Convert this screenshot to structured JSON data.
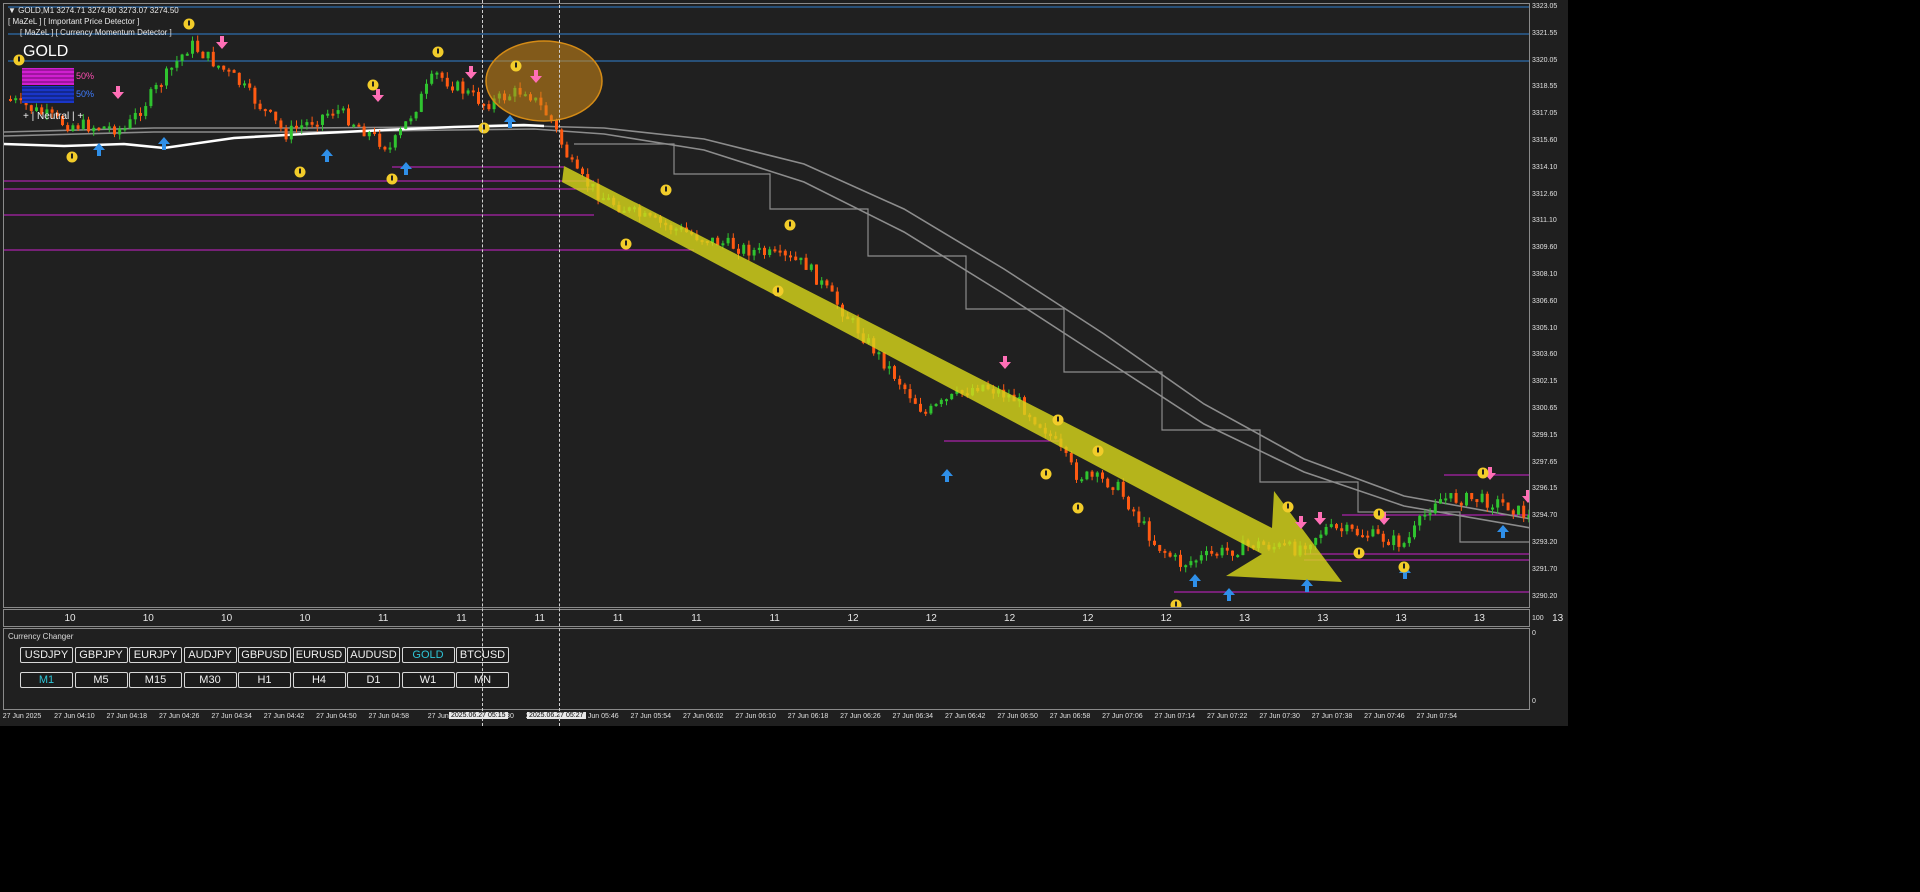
{
  "header": {
    "symbol_line": "▼ GOLD,M1  3274.71 3274.80 3273.07 3274.50",
    "indicator_1": "[ MaZeL ] [ Important Price Detector ]",
    "indicator_2": "[ MaZeL ] [ Currency Momentum Detector ]",
    "gold_label": "GOLD",
    "pct_1": "50%",
    "pct_2": "50%",
    "neutral_label": "+ | Neutral | +"
  },
  "price_scale": [
    "3323.05",
    "3321.55",
    "3320.05",
    "3318.55",
    "3317.05",
    "3315.60",
    "3314.10",
    "3312.60",
    "3311.10",
    "3309.60",
    "3308.10",
    "3306.60",
    "3305.10",
    "3303.60",
    "3302.15",
    "3300.65",
    "3299.15",
    "3297.65",
    "3296.15",
    "3294.70",
    "3293.20",
    "3291.70",
    "3290.20"
  ],
  "hour_labels": [
    "10",
    "10",
    "10",
    "10",
    "11",
    "11",
    "11",
    "11",
    "11",
    "11",
    "12",
    "12",
    "12",
    "12",
    "12",
    "13",
    "13",
    "13",
    "13",
    "13"
  ],
  "panel_scale": {
    "top": "100",
    "mid": "0",
    "bottom": "0"
  },
  "currency_changer": {
    "title": "Currency Changer",
    "symbols": [
      "USDJPY",
      "GBPJPY",
      "EURJPY",
      "AUDJPY",
      "GBPUSD",
      "EURUSD",
      "AUDUSD",
      "GOLD",
      "BTCUSD"
    ],
    "active_symbol": "GOLD",
    "timeframes": [
      "M1",
      "M5",
      "M15",
      "M30",
      "H1",
      "H4",
      "D1",
      "W1",
      "MN"
    ],
    "active_timeframe": "M1"
  },
  "time_axis": [
    "27 Jun 2025",
    "27 Jun 04:10",
    "27 Jun 04:18",
    "27 Jun 04:26",
    "27 Jun 04:34",
    "27 Jun 04:42",
    "27 Jun 04:50",
    "27 Jun 04:58",
    "27 Jun 0",
    "27 Jun 05:30",
    "27 Jun 05:38",
    "27 Jun 05:46",
    "27 Jun 05:54",
    "27 Jun 06:02",
    "27 Jun 06:10",
    "27 Jun 06:18",
    "27 Jun 06:26",
    "27 Jun 06:34",
    "27 Jun 06:42",
    "27 Jun 06:50",
    "27 Jun 06:58",
    "27 Jun 07:06",
    "27 Jun 07:14",
    "27 Jun 07:22",
    "27 Jun 07:30",
    "27 Jun 07:38",
    "27 Jun 07:46",
    "27 Jun 07:54"
  ],
  "crosshair_times": [
    "2025.06.27 05:15",
    "2025.06.27 05:27"
  ],
  "colors": {
    "bull": "#2fc42f",
    "bear": "#ff5a12",
    "arrow_up": "#2f8fe8",
    "arrow_down": "#ff6fb6",
    "signal": "#f2cc2a",
    "magenta": "#cc22cc",
    "blue_line": "#2f7fd0",
    "ma": "#8c8c8c",
    "trend_arrow": "#d7d51b",
    "highlight": "#d48b16"
  }
}
